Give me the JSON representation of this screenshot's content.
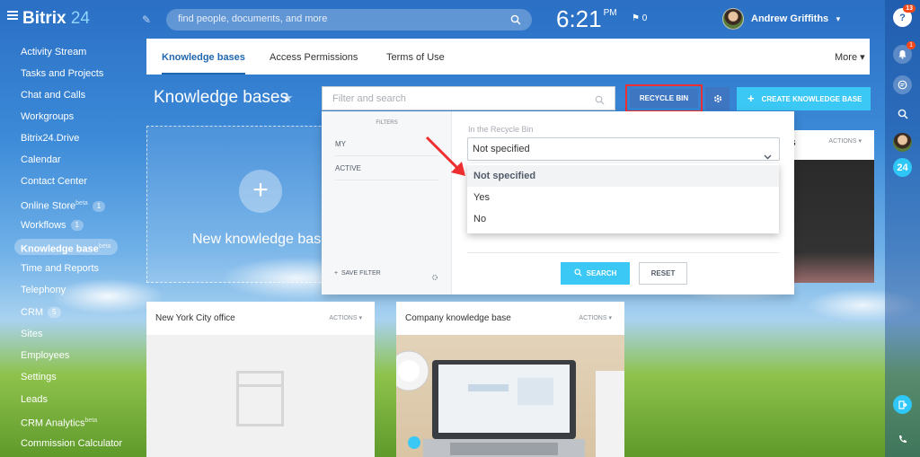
{
  "topbar": {
    "logo_text": "Bitrix",
    "logo_num": "24",
    "search_placeholder": "find people, documents, and more",
    "time": "6:21",
    "ampm": "PM",
    "flag_count": "0",
    "user_name": "Andrew Griffiths",
    "user_chevron": "▾"
  },
  "rightbar": {
    "help_badge": "13",
    "notif_badge": "1",
    "brand_badge": "24"
  },
  "sidebar": {
    "items": [
      {
        "label": "Activity Stream"
      },
      {
        "label": "Tasks and Projects"
      },
      {
        "label": "Chat and Calls"
      },
      {
        "label": "Workgroups"
      },
      {
        "label": "Bitrix24.Drive"
      },
      {
        "label": "Calendar"
      },
      {
        "label": "Contact Center"
      },
      {
        "label": "Online Store",
        "sup": "beta",
        "count": "1"
      },
      {
        "label": "Workflows",
        "count": "1"
      },
      {
        "label": "Knowledge base",
        "sup": "beta",
        "active": true
      },
      {
        "label": "Time and Reports"
      },
      {
        "label": "Telephony"
      },
      {
        "label": "CRM",
        "count": "5"
      },
      {
        "label": "Sites"
      },
      {
        "label": "Employees"
      },
      {
        "label": "Settings"
      },
      {
        "label": "Leads"
      },
      {
        "label": "CRM Analytics",
        "sup": "beta"
      },
      {
        "label": "Commission Calculator"
      }
    ]
  },
  "tabs": {
    "knowledge_bases": "Knowledge bases",
    "access_permissions": "Access Permissions",
    "terms_of_use": "Terms of Use",
    "more": "More ▾"
  },
  "page": {
    "title": "Knowledge bases",
    "filter_placeholder": "Filter and search",
    "recycle_bin": "RECYCLE BIN",
    "create_label": "CREATE KNOWLEDGE BASE",
    "new_kb_label": "New knowledge base"
  },
  "filter_panel": {
    "filters_head": "FILTERS",
    "presets": [
      "MY",
      "ACTIVE"
    ],
    "save_filter": "SAVE FILTER",
    "field_label": "In the Recycle Bin",
    "selected_value": "Not specified",
    "options": [
      "Not specified",
      "Yes",
      "No"
    ],
    "search_btn": "SEARCH",
    "reset_btn": "RESET"
  },
  "cards": {
    "behind_title": "es",
    "actions": "ACTIONS",
    "nyc_title": "New York City office",
    "company_title": "Company knowledge base"
  },
  "colors": {
    "accent_blue": "#3f76c1",
    "cyan": "#3bc8f5",
    "highlight_red": "#ee2f2f"
  }
}
